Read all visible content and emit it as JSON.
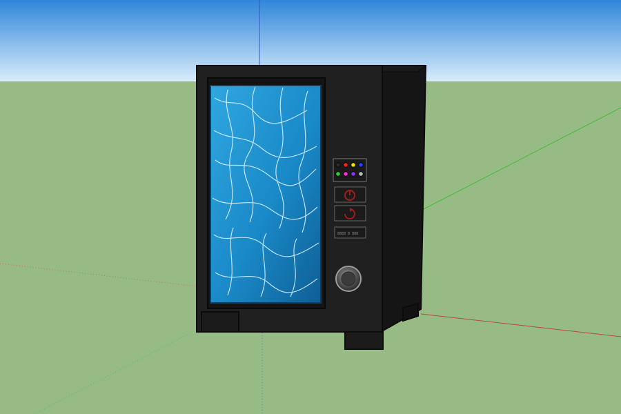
{
  "scene": {
    "sky_top": "#2f86d9",
    "sky_bottom": "#d9ecfb",
    "ground": "#97bb84"
  },
  "axes": {
    "red": "#b44a3a",
    "green": "#3dbd3d",
    "blue": "#3657c8"
  },
  "machine": {
    "body": "#202020",
    "side": "#151515",
    "edge": "#0c0c0c",
    "door_frame": "#0f0f0f",
    "glass": "#1d8ed0",
    "glass_dark": "#0f5e95",
    "caustic": "#dff6ff",
    "keypad_colors": [
      "#2a2a2a",
      "#ff2020",
      "#f2e500",
      "#2240ff",
      "#29d629",
      "#ff2dd8",
      "#8b32ff",
      "#bcbcbc"
    ],
    "power_icon": "power-icon",
    "refresh_icon": "refresh-icon",
    "coin_slot_icon": "coin-knob-icon",
    "display_text": "8888 8 888"
  }
}
